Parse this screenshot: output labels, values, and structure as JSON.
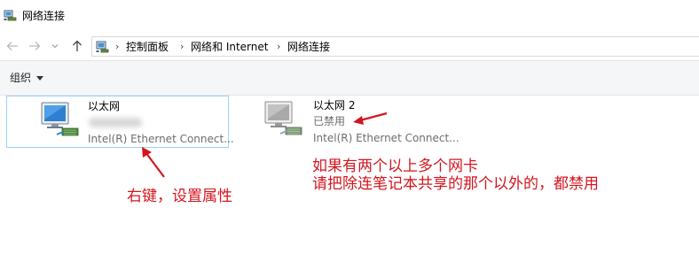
{
  "window": {
    "title": "网络连接"
  },
  "nav": {
    "back_icon": "arrow-left-icon",
    "forward_icon": "arrow-right-icon",
    "recent_icon": "chevron-down-icon",
    "up_icon": "arrow-up-icon"
  },
  "breadcrumb": {
    "items": [
      "控制面板",
      "网络和 Internet",
      "网络连接"
    ],
    "separator": "›"
  },
  "toolbar": {
    "organize_label": "组织"
  },
  "adapters": [
    {
      "name": "以太网",
      "status": "",
      "device": "Intel(R) Ethernet Connect...",
      "selected": true
    },
    {
      "name": "以太网 2",
      "status": "已禁用",
      "device": "Intel(R) Ethernet Connect...",
      "selected": false
    }
  ],
  "annotations": {
    "right_click_note": "右键，设置属性",
    "multi_nic_line1": "如果有两个以上多个网卡",
    "multi_nic_line2": "请把除连笔记本共享的那个以外的，都禁用"
  },
  "colors": {
    "annotation_red": "#d4151e",
    "selection_border": "#99d1ff",
    "toolbar_bg": "#f5f6f7"
  }
}
